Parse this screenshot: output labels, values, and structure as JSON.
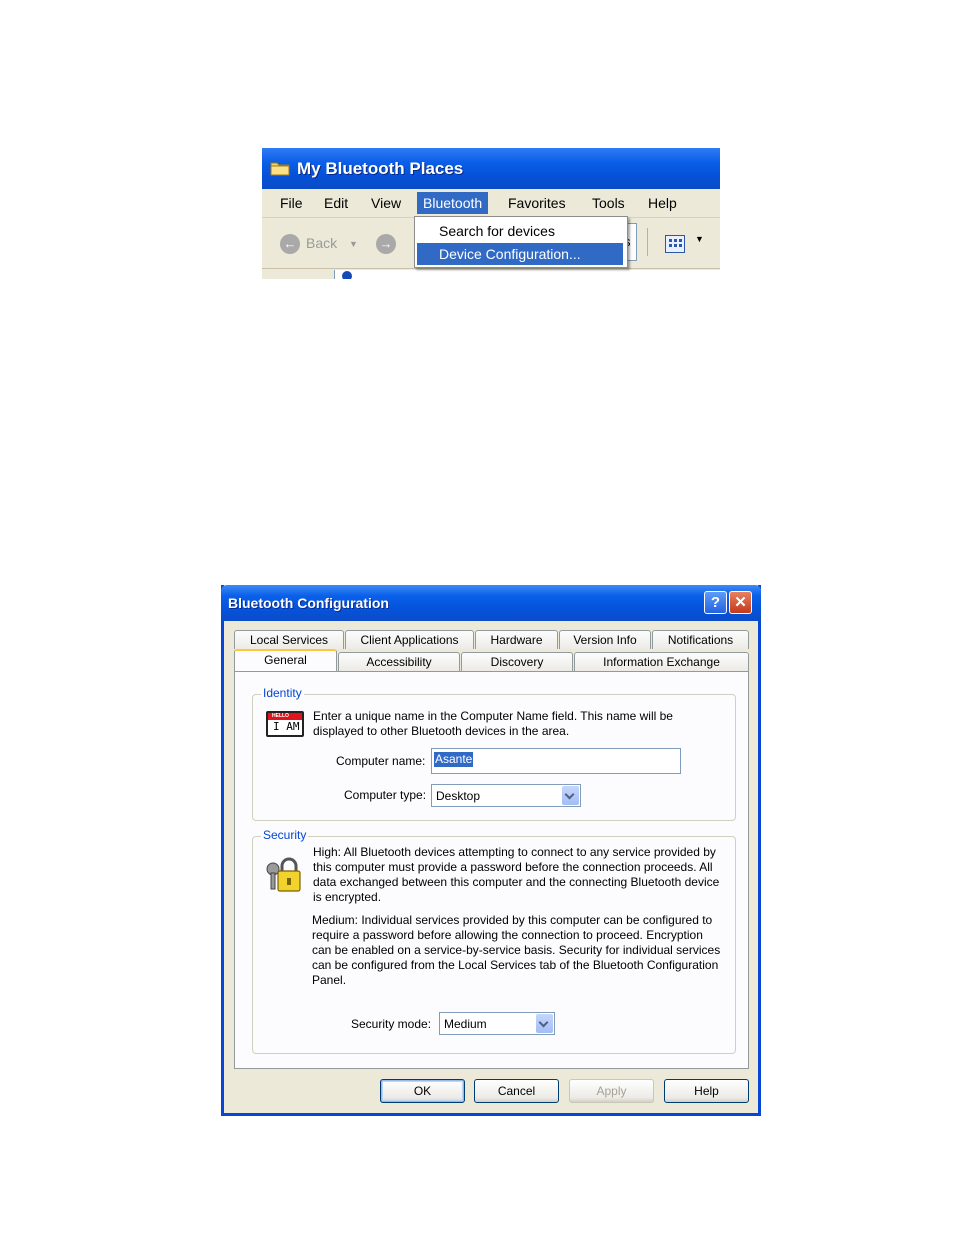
{
  "explorer": {
    "title": "My Bluetooth Places",
    "menu": [
      "File",
      "Edit",
      "View",
      "Bluetooth",
      "Favorites",
      "Tools",
      "Help"
    ],
    "active_menu": "Bluetooth",
    "back_label": "Back",
    "dropdown_items": [
      "Search for devices",
      "Device Configuration..."
    ],
    "highlighted_item": "Device Configuration...",
    "toolbar_fragment": "s"
  },
  "dialog": {
    "title": "Bluetooth Configuration",
    "help_glyph": "?",
    "close_glyph": "✕",
    "tabs_row1": [
      "Local Services",
      "Client Applications",
      "Hardware",
      "Version Info",
      "Notifications"
    ],
    "tabs_row2": [
      "General",
      "Accessibility",
      "Discovery",
      "Information Exchange"
    ],
    "selected_tab": "General",
    "identity": {
      "legend": "Identity",
      "icon_hello": "HELLO",
      "icon_text": "I AM",
      "description": "Enter a unique name in the Computer Name field. This name will be displayed to other Bluetooth devices in the area.",
      "computer_name_label": "Computer name:",
      "computer_name_value": "Asante",
      "computer_type_label": "Computer type:",
      "computer_type_value": "Desktop"
    },
    "security": {
      "legend": "Security",
      "high_text": "High: All Bluetooth devices attempting to connect to any service provided by this computer must provide a password before the connection proceeds. All data exchanged between this computer and the connecting Bluetooth device is encrypted.",
      "medium_text": "Medium: Individual services provided by this computer can be configured to require a password before allowing the connection to proceed. Encryption can be enabled on a service-by-service basis. Security for individual services can be configured from the Local Services tab of the Bluetooth Configuration Panel.",
      "mode_label": "Security mode:",
      "mode_value": "Medium"
    },
    "buttons": {
      "ok": "OK",
      "cancel": "Cancel",
      "apply": "Apply",
      "help": "Help"
    }
  }
}
